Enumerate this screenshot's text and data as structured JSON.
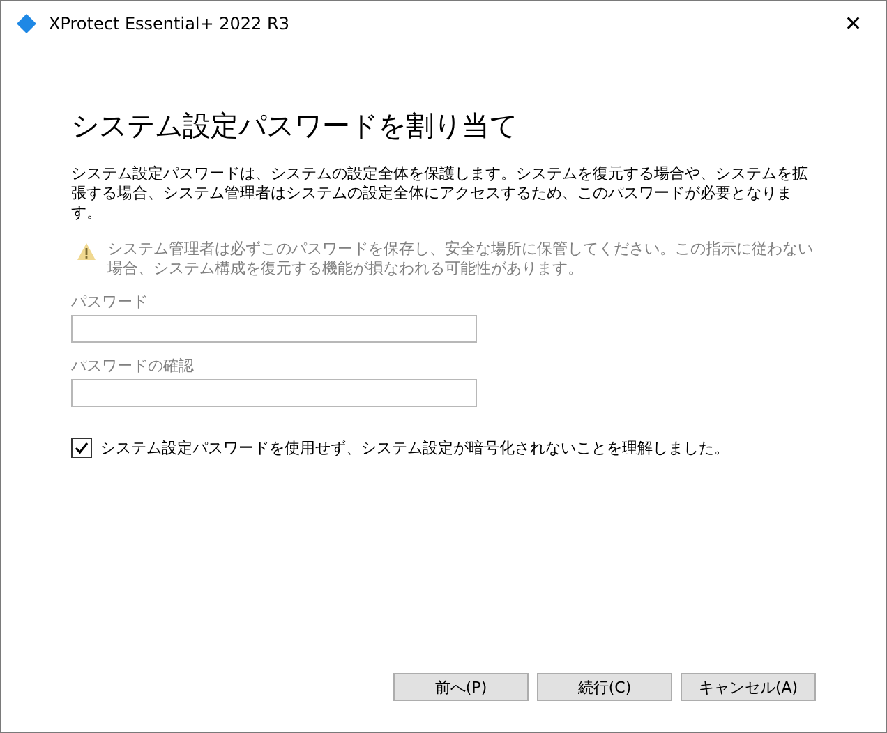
{
  "window": {
    "title": "XProtect Essential+ 2022 R3",
    "close": "✕"
  },
  "heading": "システム設定パスワードを割り当て",
  "description": "システム設定パスワードは、システムの設定全体を保護します。システムを復元する場合や、システムを拡張する場合、システム管理者はシステムの設定全体にアクセスするため、このパスワードが必要となります。",
  "warning": {
    "text": "システム管理者は必ずこのパスワードを保存し、安全な場所に保管してください。この指示に従わない場合、システム構成を復元する機能が損なわれる可能性があります。",
    "disabled": true
  },
  "fields": [
    {
      "label": "パスワード",
      "disabled": true
    },
    {
      "label": "パスワードの確認",
      "disabled": true
    }
  ],
  "checkbox": {
    "label": "システム設定パスワードを使用せず、システム設定が暗号化されないことを理解しました。",
    "checked": true
  },
  "buttons": [
    {
      "label": "前へ(P)"
    },
    {
      "label": "続行(C)"
    },
    {
      "label": "キャンセル(A)"
    }
  ]
}
